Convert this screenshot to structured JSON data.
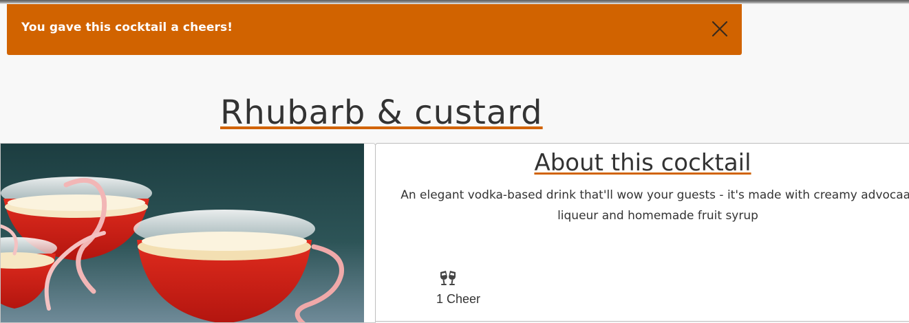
{
  "toast": {
    "message": "You gave this cocktail a cheers!",
    "close_icon": "close-icon",
    "background": "#d16300"
  },
  "cocktail": {
    "title": "Rhubarb & custard"
  },
  "about": {
    "heading": "About this cocktail",
    "description": "An elegant vodka-based drink that'll wow your guests - it's made with creamy advocaat liqueur and homemade fruit syrup"
  },
  "cheers": {
    "icon": "clinking-glasses-icon",
    "count_label": "1 Cheer"
  },
  "colors": {
    "accent": "#d16300",
    "text": "#333333",
    "page_background": "#f8f8f8"
  }
}
